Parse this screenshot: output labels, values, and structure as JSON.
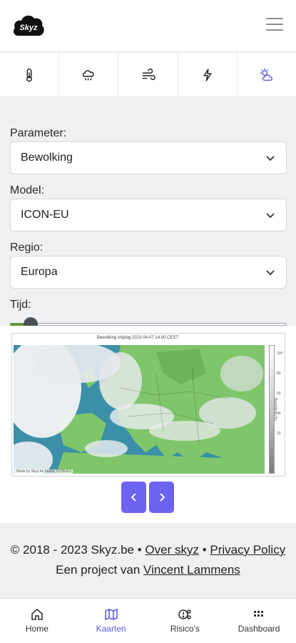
{
  "header": {
    "logo_text": "Skyz",
    "logo_icon": "cloud-logo-icon",
    "menu_icon": "hamburger-menu-icon"
  },
  "iconbar": {
    "items": [
      {
        "name": "temperature",
        "icon": "thermometer-icon"
      },
      {
        "name": "precipitation",
        "icon": "cloud-rain-icon"
      },
      {
        "name": "wind",
        "icon": "wind-icon"
      },
      {
        "name": "lightning",
        "icon": "lightning-icon"
      },
      {
        "name": "clouds",
        "icon": "cloud-sun-icon",
        "active": true
      }
    ]
  },
  "form": {
    "parameter_label": "Parameter:",
    "parameter_value": "Bewolking",
    "model_label": "Model:",
    "model_value": "ICON-EU",
    "regio_label": "Regio:",
    "regio_value": "Europa",
    "tijd_label": "Tijd:",
    "tijd_slider_fraction": 0.05
  },
  "map": {
    "title": "Bewolking Vrijdag 2023-04-07 14:00 CEST",
    "colorbar_ticks": [
      "100",
      "80",
      "60",
      "40",
      "20"
    ],
    "colorbar_label": "Bewolking (%)",
    "credit": "Made by Skyz.be Model: ICON-EU"
  },
  "footer": {
    "copyright": "© 2018 - 2023 Skyz.be",
    "separator": "•",
    "over_link": "Over skyz",
    "privacy_link": "Privacy Policy",
    "project_text": "Een project van",
    "author_link": "Vincent Lammens"
  },
  "tabbar": {
    "items": [
      {
        "label": "Home",
        "icon": "home-icon"
      },
      {
        "label": "Kaarten",
        "icon": "map-icon",
        "active": true
      },
      {
        "label": "Risico's",
        "icon": "risk-icon"
      },
      {
        "label": "Dashboard",
        "icon": "dashboard-icon"
      }
    ]
  },
  "colors": {
    "accent": "#6c63f0",
    "active_tab": "#5b5ce8",
    "slider_fill": "#5d9a3a",
    "map_land": "#7fc66a",
    "map_sea": "#3c8fa8"
  }
}
